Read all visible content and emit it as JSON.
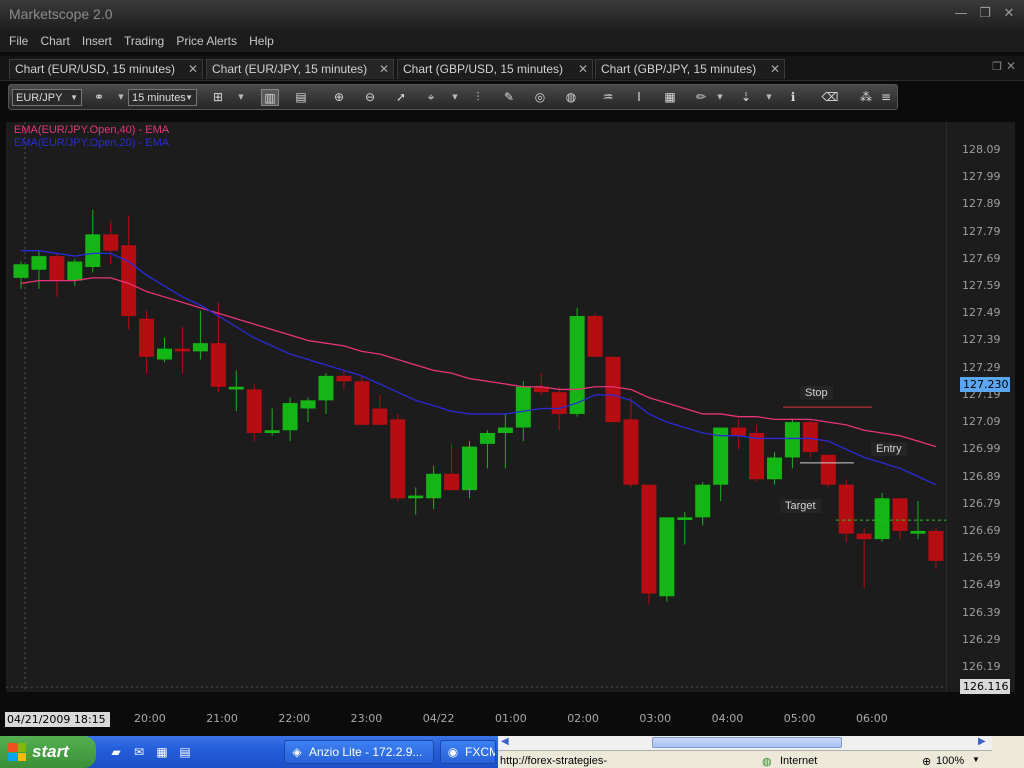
{
  "window": {
    "title": "Marketscope 2.0",
    "buttons": [
      "—",
      "❐",
      "✕"
    ]
  },
  "menu": [
    "File",
    "Chart",
    "Insert",
    "Trading",
    "Price Alerts",
    "Help"
  ],
  "tabs": [
    {
      "label": "Chart (EUR/USD, 15 minutes)",
      "active": false
    },
    {
      "label": "Chart (EUR/JPY, 15 minutes)",
      "active": true
    },
    {
      "label": "Chart (GBP/USD, 15 minutes)",
      "active": false
    },
    {
      "label": "Chart (GBP/JPY, 15 minutes)",
      "active": false
    }
  ],
  "toolbar": {
    "symbol": "EUR/JPY",
    "timeframe": "15 minutes"
  },
  "indicators": [
    {
      "label": "EMA(EUR/JPY.Open,40) - EMA",
      "color": "#e8337a"
    },
    {
      "label": "EMA(EUR/JPY.Open,20) - EMA",
      "color": "#2a2ad8"
    }
  ],
  "colors": {
    "up": "#16b516",
    "down": "#b50d12",
    "ema40": "#e8337a",
    "ema20": "#2a2ad8",
    "highlight": "#5aa6f0"
  },
  "chart_data": {
    "type": "candlestick",
    "symbol": "EUR/JPY",
    "y_ticks": [
      128.09,
      127.99,
      127.89,
      127.79,
      127.69,
      127.59,
      127.49,
      127.39,
      127.29,
      127.19,
      127.09,
      126.99,
      126.89,
      126.79,
      126.69,
      126.59,
      126.49,
      126.39,
      126.29,
      126.19
    ],
    "ylim": [
      126.116,
      128.14
    ],
    "current_price": "127.230",
    "bottom_price": "126.116",
    "x_ticks": [
      "20:00",
      "21:00",
      "22:00",
      "23:00",
      "04/22",
      "01:00",
      "02:00",
      "03:00",
      "04:00",
      "05:00",
      "06:00"
    ],
    "cursor_time": "04/21/2009 18:15",
    "candles": [
      {
        "o": 127.62,
        "h": 127.68,
        "l": 127.58,
        "c": 127.67
      },
      {
        "o": 127.65,
        "h": 127.72,
        "l": 127.58,
        "c": 127.7
      },
      {
        "o": 127.7,
        "h": 127.71,
        "l": 127.55,
        "c": 127.61
      },
      {
        "o": 127.61,
        "h": 127.69,
        "l": 127.59,
        "c": 127.68
      },
      {
        "o": 127.66,
        "h": 127.87,
        "l": 127.64,
        "c": 127.78
      },
      {
        "o": 127.78,
        "h": 127.83,
        "l": 127.67,
        "c": 127.72
      },
      {
        "o": 127.74,
        "h": 127.85,
        "l": 127.43,
        "c": 127.48
      },
      {
        "o": 127.47,
        "h": 127.5,
        "l": 127.27,
        "c": 127.33
      },
      {
        "o": 127.32,
        "h": 127.4,
        "l": 127.31,
        "c": 127.36
      },
      {
        "o": 127.36,
        "h": 127.44,
        "l": 127.27,
        "c": 127.35
      },
      {
        "o": 127.35,
        "h": 127.5,
        "l": 127.32,
        "c": 127.38
      },
      {
        "o": 127.38,
        "h": 127.53,
        "l": 127.2,
        "c": 127.22
      },
      {
        "o": 127.21,
        "h": 127.28,
        "l": 127.13,
        "c": 127.22
      },
      {
        "o": 127.21,
        "h": 127.23,
        "l": 127.02,
        "c": 127.05
      },
      {
        "o": 127.05,
        "h": 127.14,
        "l": 127.04,
        "c": 127.06
      },
      {
        "o": 127.06,
        "h": 127.18,
        "l": 127.02,
        "c": 127.16
      },
      {
        "o": 127.14,
        "h": 127.18,
        "l": 127.09,
        "c": 127.17
      },
      {
        "o": 127.17,
        "h": 127.27,
        "l": 127.12,
        "c": 127.26
      },
      {
        "o": 127.26,
        "h": 127.28,
        "l": 127.21,
        "c": 127.24
      },
      {
        "o": 127.24,
        "h": 127.26,
        "l": 127.08,
        "c": 127.08
      },
      {
        "o": 127.14,
        "h": 127.19,
        "l": 127.08,
        "c": 127.08
      },
      {
        "o": 127.1,
        "h": 127.12,
        "l": 126.8,
        "c": 126.81
      },
      {
        "o": 126.81,
        "h": 126.85,
        "l": 126.75,
        "c": 126.82
      },
      {
        "o": 126.81,
        "h": 126.93,
        "l": 126.77,
        "c": 126.9
      },
      {
        "o": 126.9,
        "h": 127.01,
        "l": 126.84,
        "c": 126.84
      },
      {
        "o": 126.84,
        "h": 127.02,
        "l": 126.81,
        "c": 127.0
      },
      {
        "o": 127.01,
        "h": 127.06,
        "l": 126.92,
        "c": 127.05
      },
      {
        "o": 127.05,
        "h": 127.12,
        "l": 126.92,
        "c": 127.07
      },
      {
        "o": 127.07,
        "h": 127.24,
        "l": 127.02,
        "c": 127.22
      },
      {
        "o": 127.22,
        "h": 127.27,
        "l": 127.19,
        "c": 127.2
      },
      {
        "o": 127.2,
        "h": 127.22,
        "l": 127.06,
        "c": 127.12
      },
      {
        "o": 127.12,
        "h": 127.51,
        "l": 127.11,
        "c": 127.48
      },
      {
        "o": 127.48,
        "h": 127.49,
        "l": 127.33,
        "c": 127.33
      },
      {
        "o": 127.33,
        "h": 127.33,
        "l": 127.09,
        "c": 127.09
      },
      {
        "o": 127.1,
        "h": 127.18,
        "l": 126.85,
        "c": 126.86
      },
      {
        "o": 126.86,
        "h": 126.86,
        "l": 126.42,
        "c": 126.46
      },
      {
        "o": 126.45,
        "h": 126.74,
        "l": 126.43,
        "c": 126.74
      },
      {
        "o": 126.73,
        "h": 126.76,
        "l": 126.64,
        "c": 126.74
      },
      {
        "o": 126.74,
        "h": 126.87,
        "l": 126.71,
        "c": 126.86
      },
      {
        "o": 126.86,
        "h": 127.07,
        "l": 126.8,
        "c": 127.07
      },
      {
        "o": 127.07,
        "h": 127.1,
        "l": 126.99,
        "c": 127.04
      },
      {
        "o": 127.05,
        "h": 127.08,
        "l": 126.87,
        "c": 126.88
      },
      {
        "o": 126.88,
        "h": 126.98,
        "l": 126.86,
        "c": 126.96
      },
      {
        "o": 126.96,
        "h": 127.1,
        "l": 126.92,
        "c": 127.09
      },
      {
        "o": 127.09,
        "h": 127.1,
        "l": 126.96,
        "c": 126.98
      },
      {
        "o": 126.97,
        "h": 126.97,
        "l": 126.85,
        "c": 126.86
      },
      {
        "o": 126.86,
        "h": 126.88,
        "l": 126.65,
        "c": 126.68
      },
      {
        "o": 126.68,
        "h": 126.7,
        "l": 126.48,
        "c": 126.66
      },
      {
        "o": 126.66,
        "h": 126.83,
        "l": 126.65,
        "c": 126.81
      },
      {
        "o": 126.81,
        "h": 126.81,
        "l": 126.66,
        "c": 126.69
      },
      {
        "o": 126.68,
        "h": 126.8,
        "l": 126.66,
        "c": 126.69
      },
      {
        "o": 126.69,
        "h": 126.7,
        "l": 126.55,
        "c": 126.58
      }
    ],
    "ema40": [
      127.6,
      127.61,
      127.61,
      127.61,
      127.62,
      127.62,
      127.6,
      127.57,
      127.55,
      127.53,
      127.51,
      127.49,
      127.47,
      127.45,
      127.43,
      127.41,
      127.39,
      127.38,
      127.37,
      127.35,
      127.34,
      127.32,
      127.3,
      127.28,
      127.27,
      127.25,
      127.24,
      127.23,
      127.22,
      127.22,
      127.21,
      127.21,
      127.22,
      127.22,
      127.21,
      127.18,
      127.16,
      127.14,
      127.12,
      127.12,
      127.11,
      127.11,
      127.1,
      127.1,
      127.1,
      127.09,
      127.08,
      127.06,
      127.05,
      127.04,
      127.02,
      127.0
    ],
    "ema20": [
      127.72,
      127.72,
      127.71,
      127.7,
      127.71,
      127.71,
      127.68,
      127.63,
      127.59,
      127.55,
      127.52,
      127.48,
      127.44,
      127.4,
      127.37,
      127.34,
      127.32,
      127.3,
      127.28,
      127.26,
      127.23,
      127.2,
      127.17,
      127.15,
      127.13,
      127.12,
      127.12,
      127.12,
      127.13,
      127.14,
      127.14,
      127.16,
      127.19,
      127.19,
      127.17,
      127.12,
      127.09,
      127.07,
      127.05,
      127.04,
      127.04,
      127.03,
      127.03,
      127.03,
      127.03,
      127.02,
      126.99,
      126.96,
      126.94,
      126.92,
      126.89,
      126.86
    ],
    "annotations": [
      {
        "label": "Stop",
        "price": 127.145
      },
      {
        "label": "Entry",
        "price": 126.94
      },
      {
        "label": "Target",
        "price": 126.73
      }
    ]
  },
  "taskbar": {
    "start_label": "start",
    "tasks": [
      {
        "label": "Anzio Lite - 172.2.9...",
        "icon": "◈"
      },
      {
        "label": "FXCM",
        "icon": "◉"
      }
    ],
    "ie_url": "http://forex-strategies-",
    "ie_zone": "Internet",
    "ie_zoom": "100%"
  }
}
